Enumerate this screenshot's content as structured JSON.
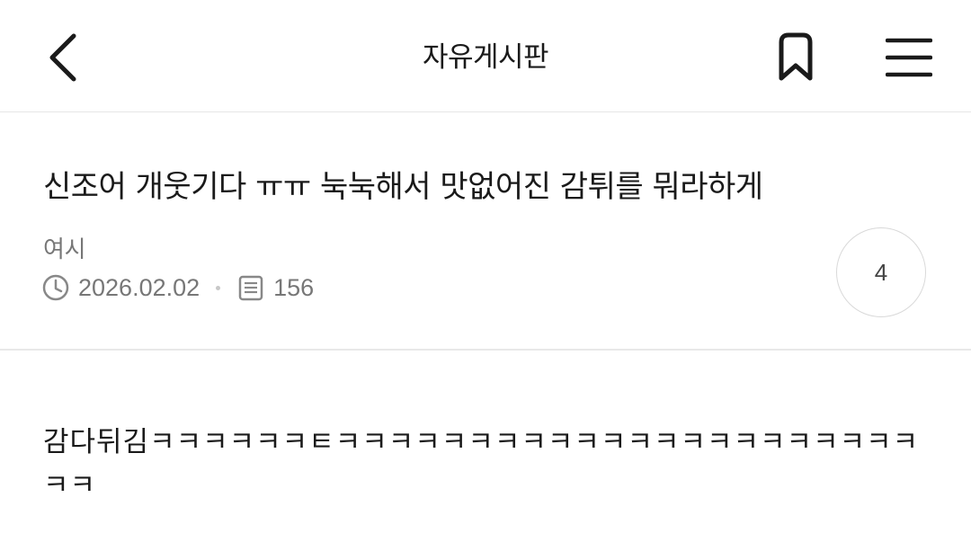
{
  "header": {
    "title": "자유게시판",
    "back_icon": "chevron-left-icon",
    "bookmark_icon": "bookmark-icon",
    "menu_icon": "hamburger-menu-icon"
  },
  "post": {
    "title": "신조어 개웃기다 ㅠㅠ 눅눅해서 맛없어진 감튀를 뭐라하게",
    "author": "여시",
    "date": "2026.02.02",
    "views": "156",
    "comment_count": "4",
    "body": "감다뒤김ㅋㅋㅋㅋㅋㅋㅌㅋㅋㅋㅋㅋㅋㅋㅋㅋㅋㅋㅋㅋㅋㅋㅋㅋㅋㅋㅋㅋㅋㅋㅋ"
  },
  "colors": {
    "text": "#1a1a1a",
    "meta": "#777777",
    "divider": "#e6e6e6"
  }
}
